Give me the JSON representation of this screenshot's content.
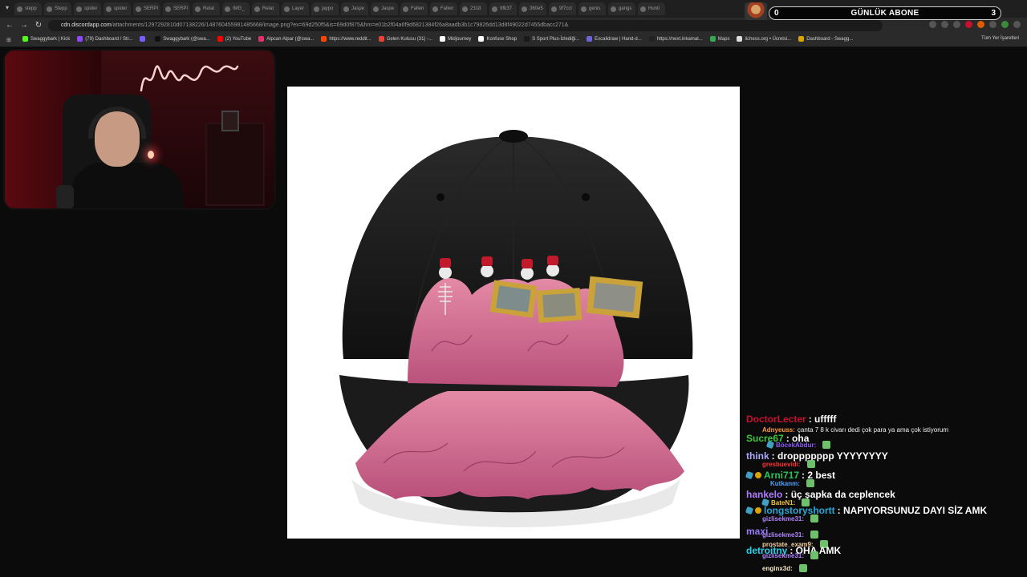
{
  "browser": {
    "tabs": [
      "stepp",
      "Stepp",
      "spider",
      "spider",
      "SERPI",
      "SERPI",
      "Relat",
      "IMG_",
      "Relat",
      "Layer",
      "jaypo",
      "Jaspe",
      "Jaspe",
      "Fallen",
      "Fallen",
      "2318",
      "9fb37",
      "360e5",
      "9f7ccl",
      "genis",
      "gangs",
      "Hunti"
    ],
    "url_host": "cdn.discordapp.com",
    "url_path": "/attachments/1297292810d07138226/148760455981485668/image.png?ex=69d250f5&is=69d0f875&hm=e01b2f04a6f9d6821384f26a8aadb3b1c79826dd13d8f49022d7455dbacc271&",
    "bookmarks": [
      {
        "label": "Swaggybark | Kick",
        "color": "#53fc18"
      },
      {
        "label": "(79) Dashboard / Str...",
        "color": "#9146ff"
      },
      {
        "label": "",
        "color": "#7b5cff"
      },
      {
        "label": "Swaggybark (@swa...",
        "color": "#111111"
      },
      {
        "label": "(2) YouTube",
        "color": "#ff0000"
      },
      {
        "label": "Alpcan Alpar (@swa...",
        "color": "#e1306c"
      },
      {
        "label": "https://www.reddit...",
        "color": "#ff4500"
      },
      {
        "label": "Gelen Kutusu (31) -...",
        "color": "#ea4335"
      },
      {
        "label": "Midjourney",
        "color": "#ffffff"
      },
      {
        "label": "Konfuse Shop",
        "color": "#ffffff"
      },
      {
        "label": "S Sport Plus-İzlediği...",
        "color": "#1a1a1a"
      },
      {
        "label": "Excalidraw | Hand-d...",
        "color": "#6965db"
      },
      {
        "label": "https://next.inkamat...",
        "color": "#222222"
      },
      {
        "label": "Maps",
        "color": "#34a853"
      },
      {
        "label": "lichess.org • Ücretsi...",
        "color": "#dddddd"
      },
      {
        "label": "Dashboard - Swagg...",
        "color": "#d9a400"
      }
    ],
    "all_bookmarks": "Tüm Yer İşaretleri"
  },
  "subscriber_widget": {
    "left_count": "0",
    "title": "GÜNLÜK ABONE",
    "right_count": "3"
  },
  "chat": [
    {
      "size": "big",
      "user": "DoctorLecter",
      "color": "#c8102e",
      "text": ": ufffff",
      "badges": 0
    },
    {
      "size": "small",
      "user": "Adnyeuss:",
      "color": "#ff9a3c",
      "text": "çanta 7 8 k civarı dedi çok para ya ama çok istiyorum",
      "badges": 0
    },
    {
      "size": "big",
      "user": "Sucre67",
      "color": "#3ec63e",
      "text": ": oha",
      "badges": 0
    },
    {
      "size": "small",
      "user": "BöcekAbdur:",
      "color": "#8b5cf6",
      "text": "",
      "badges": 1,
      "emote": true
    },
    {
      "size": "big",
      "user": "think",
      "color": "#a8a8ff",
      "text": ": droppppppp YYYYYYYY",
      "badges": 0
    },
    {
      "size": "small",
      "user": "gresbuevidi:",
      "color": "#ff3333",
      "text": "",
      "badges": 0,
      "emote": true
    },
    {
      "size": "big",
      "user": "Arni717",
      "color": "#22c55e",
      "text": ": 2 best",
      "badges": 2
    },
    {
      "size": "small",
      "user": "Kutkanm:",
      "color": "#4ea1ff",
      "text": "",
      "badges": 0,
      "emote": true
    },
    {
      "size": "big",
      "user": "hankelo",
      "color": "#b07cff",
      "text": ": üç şapka da ceplencek",
      "badges": 0
    },
    {
      "size": "small",
      "user": "BateN1:",
      "color": "#f0c040",
      "text": "",
      "badges": 1,
      "emote": true
    },
    {
      "size": "big",
      "user": "longstoryshortt",
      "color": "#2aa7d8",
      "text": ": NAPIYORSUNUZ DAYI SİZ AMK",
      "badges": 2
    },
    {
      "size": "small",
      "user": "gizlisekme31:",
      "color": "#b084ff",
      "text": "",
      "badges": 0,
      "emote": true
    },
    {
      "size": "big",
      "user": "maxi",
      "color": "#9b7bff",
      "text": "",
      "badges": 0
    },
    {
      "size": "small",
      "user": "gizlisekme31:",
      "color": "#b084ff",
      "text": "",
      "badges": 0,
      "emote": true
    },
    {
      "size": "small",
      "user": "prostate_exam9:",
      "color": "#f5d0a0",
      "text": "",
      "badges": 0,
      "emote": true
    },
    {
      "size": "big",
      "user": "detroitny",
      "color": "#22d3ee",
      "text": ": OHA AMK",
      "badges": 0
    },
    {
      "size": "small",
      "user": "gizlisekme31:",
      "color": "#b084ff",
      "text": "",
      "badges": 0,
      "emote": true
    },
    {
      "size": "small",
      "user": "enginx3d:",
      "color": "#f5e6c8",
      "text": "",
      "badges": 0,
      "emote": true
    }
  ],
  "colors": {
    "accent": "#c8102e",
    "page_bg": "#0b0b0b",
    "cap_black": "#151515",
    "cap_pink": "#d9708f"
  }
}
